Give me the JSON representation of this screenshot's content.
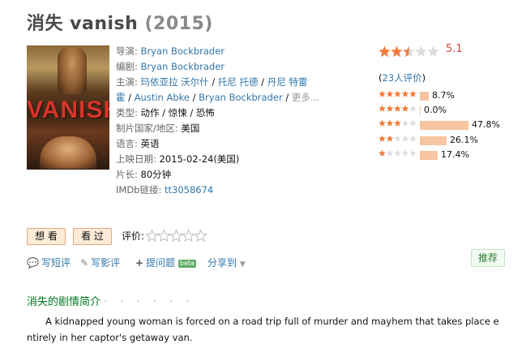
{
  "title": {
    "name": "消失 vanish",
    "year": "(2015)"
  },
  "poster": {
    "logo_text": "VANISH"
  },
  "info": {
    "director_label": "导演:",
    "director": "Bryan Bockbrader",
    "writer_label": "编剧:",
    "writer": "Bryan Bockbrader",
    "cast_label": "主演:",
    "cast": [
      "玛依亚拉 沃尔什",
      "托尼 托德",
      "丹尼 特雷霍",
      "Austin Abke",
      "Bryan Bockbrader"
    ],
    "cast_more": "更多...",
    "genre_label": "类型:",
    "genre": "动作 / 惊悚 / 恐怖",
    "country_label": "制片国家/地区:",
    "country": "美国",
    "language_label": "语言:",
    "language": "英语",
    "release_label": "上映日期:",
    "release": "2015-02-24(美国)",
    "runtime_label": "片长:",
    "runtime": "80分钟",
    "imdb_label": "IMDb链接:",
    "imdb": "tt3058674"
  },
  "rating": {
    "score": "5.1",
    "score_stars": 2.5,
    "votes_text": "(23人评价)",
    "votes_pre": "(",
    "votes_link": "23人评价",
    "votes_post": ")",
    "distribution": [
      {
        "stars": 5,
        "percent": 8.7,
        "label": "8.7%"
      },
      {
        "stars": 4,
        "percent": 0.0,
        "label": "0.0%"
      },
      {
        "stars": 3,
        "percent": 47.8,
        "label": "47.8%"
      },
      {
        "stars": 2,
        "percent": 26.1,
        "label": "26.1%"
      },
      {
        "stars": 1,
        "percent": 17.4,
        "label": "17.4%"
      }
    ]
  },
  "actions": {
    "want_label": "想 看",
    "watched_label": "看 过",
    "rate_label": "评价:",
    "short_review": "写短评",
    "review": "写影评",
    "question": "提问题",
    "beta": "beta",
    "share": "分享到",
    "recommend": "推荐"
  },
  "summary": {
    "heading": "消失的剧情简介",
    "dots": "· · · · · ·",
    "text": "A kidnapped young woman is forced on a road trip full of murder and mayhem that takes place entirely in her captor's getaway van."
  },
  "colors": {
    "star_full": "#f47a3a",
    "star_empty": "#dddddd",
    "bar": "#f7c5a0",
    "link": "#3377aa",
    "accent_green": "#007722"
  }
}
